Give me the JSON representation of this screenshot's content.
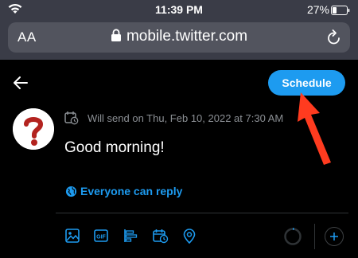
{
  "status_bar": {
    "time": "11:39 PM",
    "battery": "27%"
  },
  "browser": {
    "text_size_label": "AA",
    "url": "mobile.twitter.com"
  },
  "compose": {
    "schedule_label": "Schedule",
    "scheduled_info": "Will send on Thu, Feb 10, 2022 at 7:30 AM",
    "tweet_text": "Good morning!",
    "reply_setting": "Everyone can reply"
  },
  "toolbar": {
    "icons": [
      "image-icon",
      "gif-icon",
      "poll-icon",
      "schedule-icon",
      "location-icon"
    ]
  },
  "colors": {
    "accent": "#1d9bf0",
    "annotation_arrow": "#ff3b1f",
    "browser_chrome": "#3a3c47"
  }
}
